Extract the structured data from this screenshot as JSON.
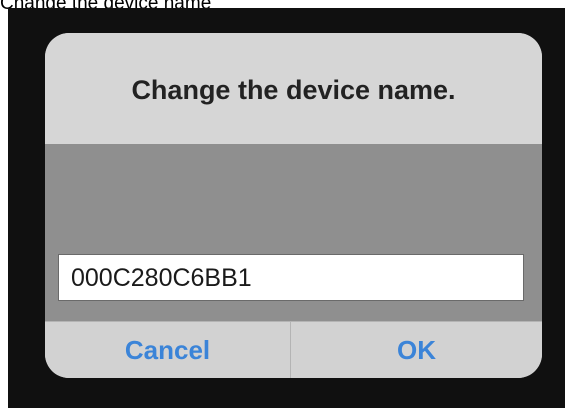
{
  "caption": "Change the device name",
  "dialog": {
    "title": "Change the device name.",
    "input": {
      "value": "000C280C6BB1"
    },
    "buttons": {
      "cancel_label": "Cancel",
      "ok_label": "OK"
    }
  },
  "colors": {
    "accent": "#3b84d8",
    "backdrop": "#101010",
    "dialog_bg": "#d6d6d6",
    "body_bg": "#8f8f8f"
  }
}
